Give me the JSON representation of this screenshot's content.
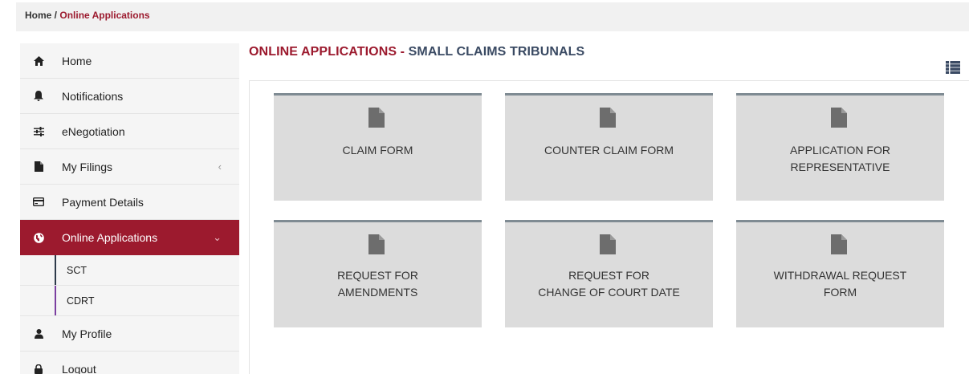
{
  "breadcrumb": {
    "home": "Home",
    "separator": " / ",
    "current": "Online Applications"
  },
  "sidebar": {
    "items": [
      {
        "label": "Home",
        "icon": "home-icon"
      },
      {
        "label": "Notifications",
        "icon": "bell-icon"
      },
      {
        "label": "eNegotiation",
        "icon": "sliders-icon"
      },
      {
        "label": "My Filings",
        "icon": "file-icon"
      },
      {
        "label": "Payment Details",
        "icon": "credit-card-icon"
      },
      {
        "label": "Online Applications",
        "icon": "globe-icon"
      },
      {
        "label": "My Profile",
        "icon": "user-icon"
      },
      {
        "label": "Logout",
        "icon": "lock-icon"
      }
    ],
    "subitems": [
      {
        "label": "SCT"
      },
      {
        "label": "CDRT"
      }
    ],
    "colors": {
      "active_bg": "#9c1a2e",
      "sct_bar": "#2d3a4a",
      "cdrt_bar": "#7b3fa0"
    }
  },
  "main": {
    "title_prefix": "ONLINE APPLICATIONS - ",
    "title_suffix": "SMALL CLAIMS TRIBUNALS",
    "cards": [
      {
        "label": "CLAIM FORM"
      },
      {
        "label": "COUNTER CLAIM FORM"
      },
      {
        "label": "APPLICATION FOR\nREPRESENTATIVE"
      },
      {
        "label": "REQUEST FOR\nAMENDMENTS"
      },
      {
        "label": "REQUEST FOR\nCHANGE OF COURT DATE"
      },
      {
        "label": "WITHDRAWAL REQUEST\nFORM"
      }
    ],
    "colors": {
      "title_red": "#9c1a2e",
      "title_navy": "#3a4a63",
      "card_bg": "#dcdcdc",
      "card_border": "#7f8b93"
    }
  }
}
